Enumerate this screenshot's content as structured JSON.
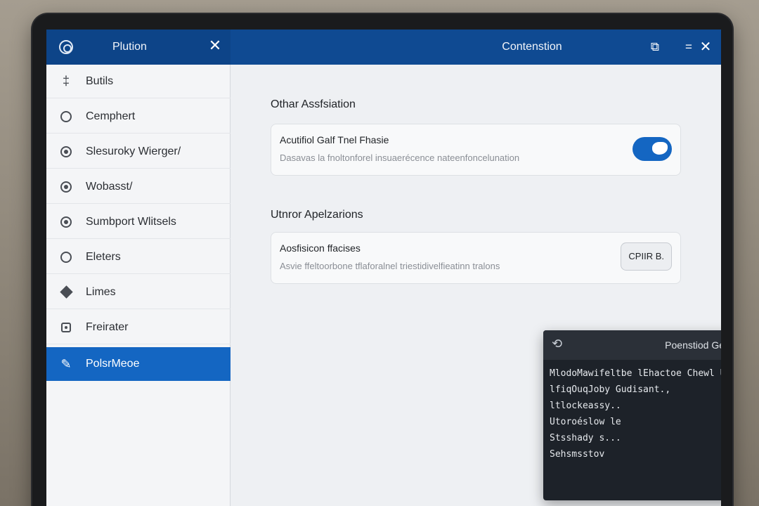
{
  "window": {
    "app_title": "Plution",
    "title": "Contenstion",
    "controls": [
      "restore-icon",
      "minimize-icon",
      "close-icon"
    ]
  },
  "sidebar": {
    "items": [
      {
        "label": "Butils",
        "icon": "pin-icon"
      },
      {
        "label": "Cemphert",
        "icon": "circle-icon"
      },
      {
        "label": "Slesuroky Wierger/",
        "icon": "globe-icon"
      },
      {
        "label": "Wobasst/",
        "icon": "radio-icon"
      },
      {
        "label": "Sumbport Wlitsels",
        "icon": "radio-icon"
      },
      {
        "label": "Eleters",
        "icon": "circle-icon"
      },
      {
        "label": "Limes",
        "icon": "diamond-icon"
      },
      {
        "label": "Freirater",
        "icon": "square-icon"
      },
      {
        "label": "PolsrMeoe",
        "icon": "brush-icon",
        "active": true
      }
    ]
  },
  "main": {
    "section1": {
      "title": "Othar Assfsiation",
      "card": {
        "title": "Acutifiol Galf Tnel Fhasie",
        "desc": "Dasavas la fnoltonforel insuaerécence nateenfoncelunation",
        "toggle_on": true
      }
    },
    "section2": {
      "title": "Utnror Apelzarions",
      "card": {
        "title": "Aosfisicon ffacises",
        "desc": "Asvie ffeltoorbone tflaforalnel triestidivelfieatinn tralons",
        "button": "CPIIR B."
      }
    }
  },
  "terminal": {
    "title": "Poenstiod Gensepuion",
    "lines": [
      "MlodoMawifeltbe lEhactoe Chewl Utlazoy Ubsilend",
      "lfiqOuqJoby Gudisant.,",
      "ltlockeassy..",
      "Utoroéslow le",
      "Stsshady s...",
      "Sehsmsstov"
    ]
  },
  "colors": {
    "accent": "#1466c2",
    "titlebar": "#0f4a92",
    "terminal_bg": "#1d2229"
  }
}
